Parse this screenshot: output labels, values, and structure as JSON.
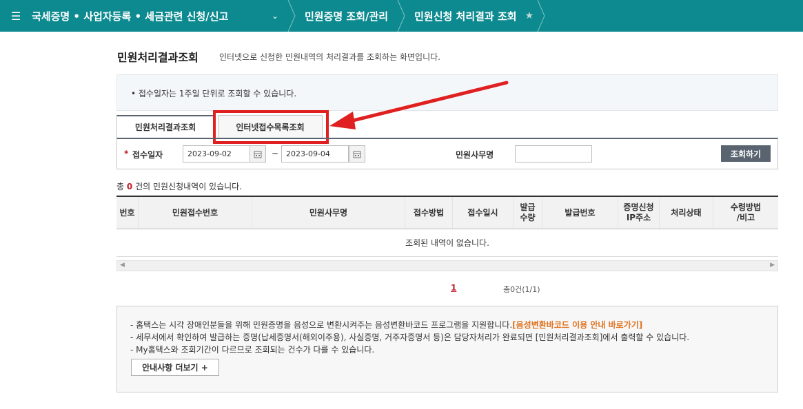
{
  "nav": {
    "menu_icon": "☰",
    "section": "국세증명 • 사업자등록 • 세금관련 신청/신고",
    "chevron": "⌄",
    "crumb1": "민원증명 조회/관리",
    "crumb2": "민원신청 처리결과 조회",
    "star": "★"
  },
  "page": {
    "title": "민원처리결과조회",
    "description": "인터넷으로 신청한 민원내역의 처리결과를 조회하는 화면입니다."
  },
  "notice": "• 접수일자는 1주일 단위로 조회할 수 있습니다.",
  "tabs": [
    {
      "label": "민원처리결과조회",
      "active": true
    },
    {
      "label": "인터넷접수목록조회",
      "active": false
    }
  ],
  "search": {
    "required_mark": "*",
    "date_label": "접수일자",
    "date_from": "2023-09-02",
    "tilde": "~",
    "date_to": "2023-09-04",
    "office_label": "민원사무명",
    "office_value": "",
    "button": "조회하기"
  },
  "count": {
    "prefix": "총",
    "value": "0",
    "suffix": "건의 민원신청내역이 있습니다."
  },
  "table": {
    "headers": [
      "번호",
      "민원접수번호",
      "민원사무명",
      "접수방법",
      "접수일시",
      "발급\n수량",
      "발급번호",
      "증명신청\nIP주소",
      "처리상태",
      "수령방법\n/비고"
    ],
    "empty_message": "조회된 내역이 없습니다."
  },
  "pagination": {
    "current": "1",
    "total": "총0건(1/1)"
  },
  "info": {
    "line1": "- 홈택스는 시각 장애인분들을 위해 민원증명을 음성으로 변환시켜주는 음성변환바코드 프로그램을 지원합니다.",
    "line1_link": "[음성변환바코드 이용 안내 바로가기]",
    "line2": "- 세무서에서 확인하여 발급하는 증명(납세증명서(해외이주용), 사실증명, 거주자증명서 등)은 담당자처리가 완료되면 [민원처리결과조회]에서 출력할 수 있습니다.",
    "line3": "- My홈택스와 조회기간이 다르므로 조회되는 건수가 다를 수 있습니다.",
    "more_button": "안내사항 더보기 +"
  },
  "colors": {
    "nav_bg": "#0d8a8f",
    "highlight": "#e02020",
    "accent_red": "#c0202d",
    "link_orange": "#e0701a"
  },
  "icons": {
    "calendar": "calendar-icon",
    "menu": "hamburger-icon",
    "favorite": "star-icon"
  }
}
